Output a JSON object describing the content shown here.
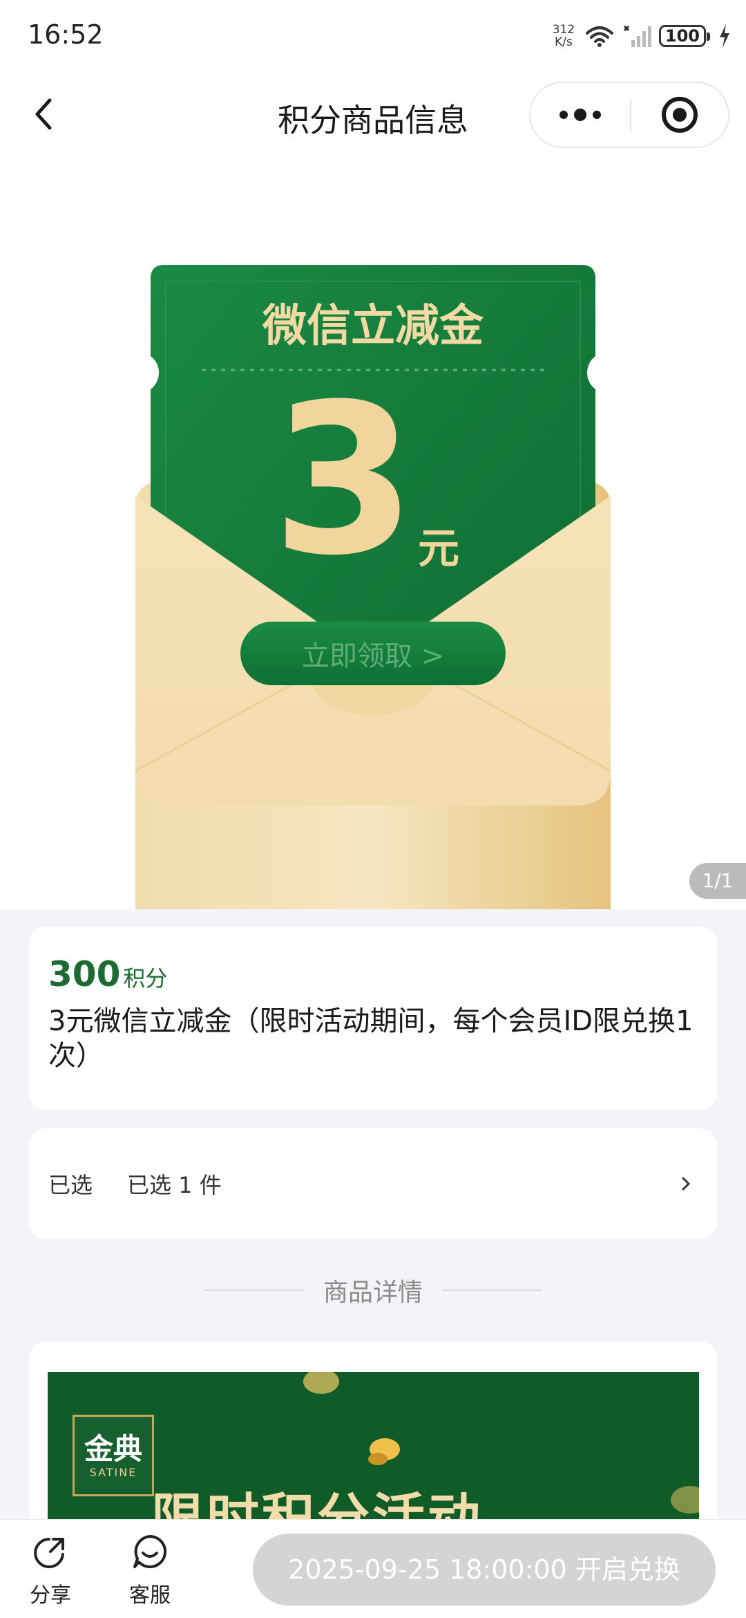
{
  "status_bar": {
    "time": "16:52",
    "net_speed_value": "312",
    "net_speed_unit": "K/s",
    "battery": "100"
  },
  "nav": {
    "title": "积分商品信息",
    "back_icon": "chevron-left-icon",
    "more_icon": "more-dots-icon",
    "close_icon": "target-circle-icon"
  },
  "banner": {
    "coupon_title": "微信立减金",
    "amount": "3",
    "currency": "元",
    "cta": "立即领取 >",
    "counter": "1/1",
    "colors": {
      "green": "#167a3a",
      "gold": "#e9c987"
    }
  },
  "product": {
    "points_value": "300",
    "points_unit": "积分",
    "name": "3元微信立减金（限时活动期间，每个会员ID限兑换1次）"
  },
  "selection": {
    "label": "已选",
    "value": "已选 1 件"
  },
  "detail": {
    "section_title": "商品详情",
    "logo_cn": "金典",
    "logo_en": "SATINE",
    "headline": "限时积分活动"
  },
  "bottom_bar": {
    "share_label": "分享",
    "service_label": "客服",
    "redeem_label": "2025-09-25 18:00:00 开启兑换"
  }
}
